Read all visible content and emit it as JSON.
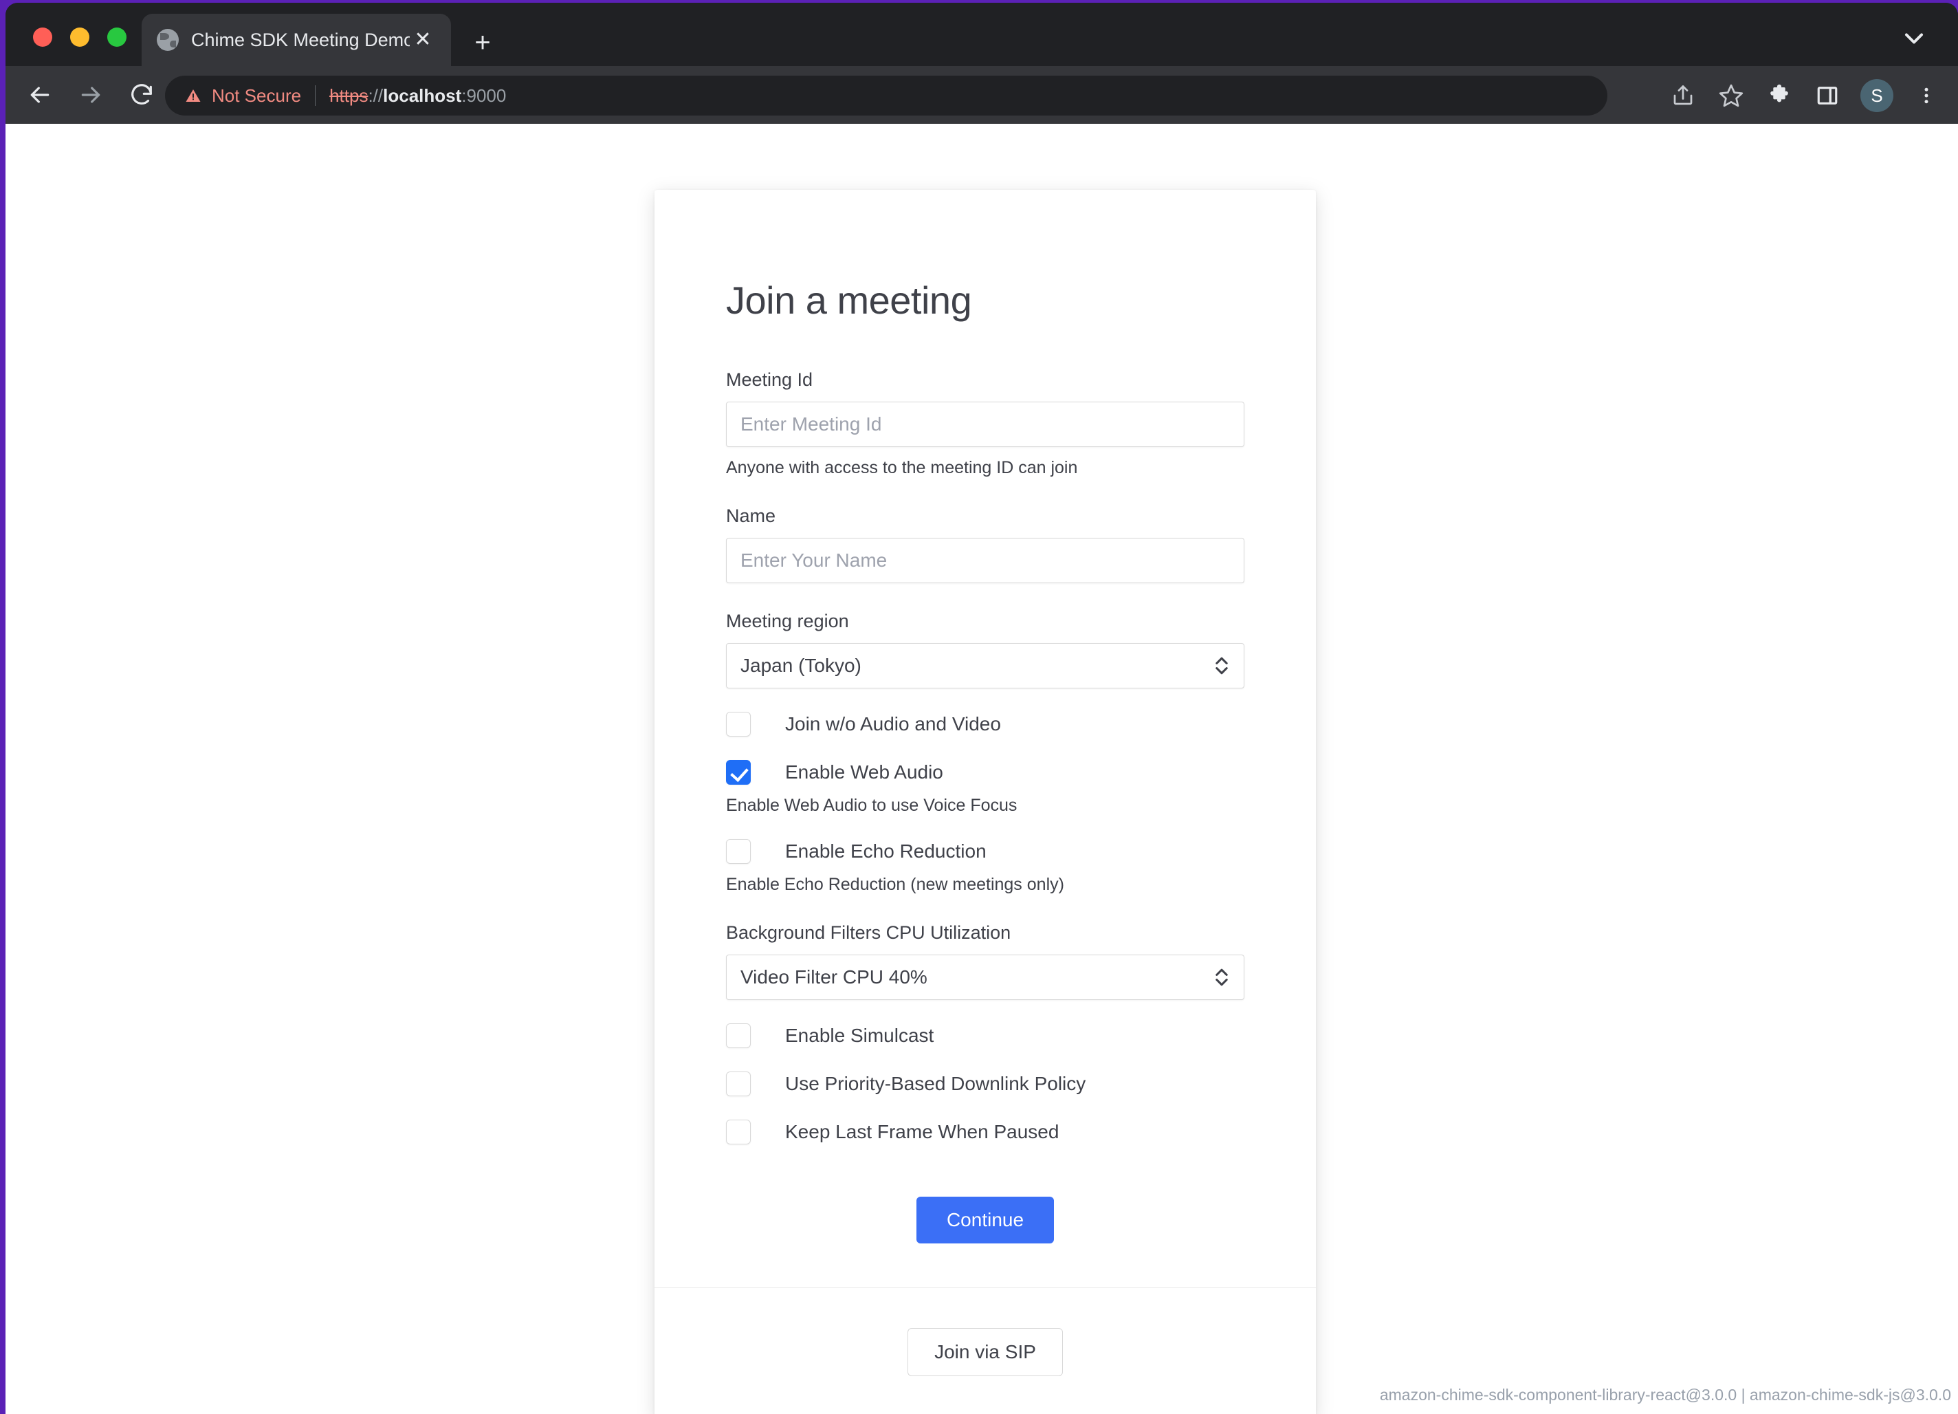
{
  "browser": {
    "tab": {
      "title": "Chime SDK Meeting Demo",
      "close_label": "✕",
      "favicon": "globe-icon"
    },
    "new_tab_label": "+",
    "nav": {
      "back_label": "←",
      "forward_label": "→",
      "reload_label": "↻"
    },
    "omnibox": {
      "security_label": "Not Secure",
      "url_scheme": "https",
      "url_slashes": "://",
      "url_host": "localhost",
      "url_port": ":9000"
    },
    "toolbar_icons": {
      "share": "share-icon",
      "bookmark": "star-icon",
      "extensions": "puzzle-icon",
      "side_panel": "side-panel-icon",
      "profile_initial": "S",
      "menu": "three-dot-menu-icon"
    }
  },
  "page": {
    "card": {
      "title": "Join a meeting",
      "meeting_id": {
        "label": "Meeting Id",
        "value": "",
        "placeholder": "Enter Meeting Id",
        "helper": "Anyone with access to the meeting ID can join"
      },
      "name": {
        "label": "Name",
        "value": "",
        "placeholder": "Enter Your Name"
      },
      "region": {
        "label": "Meeting region",
        "selected": "Japan (Tokyo)"
      },
      "checkboxes_top": [
        {
          "label": "Join w/o Audio and Video",
          "checked": false,
          "helper": ""
        },
        {
          "label": "Enable Web Audio",
          "checked": true,
          "helper": "Enable Web Audio to use Voice Focus"
        },
        {
          "label": "Enable Echo Reduction",
          "checked": false,
          "helper": "Enable Echo Reduction (new meetings only)"
        }
      ],
      "cpu": {
        "label": "Background Filters CPU Utilization",
        "selected": "Video Filter CPU 40%"
      },
      "checkboxes_bottom": [
        {
          "label": "Enable Simulcast",
          "checked": false
        },
        {
          "label": "Use Priority-Based Downlink Policy",
          "checked": false
        },
        {
          "label": "Keep Last Frame When Paused",
          "checked": false
        }
      ],
      "continue_label": "Continue",
      "sip_label": "Join via SIP"
    },
    "version_footer": "amazon-chime-sdk-component-library-react@3.0.0 | amazon-chime-sdk-js@3.0.0"
  },
  "colors": {
    "accent": "#3b6ff6",
    "checkbox_checked": "#1f6ef6",
    "warning": "#f28b82",
    "text": "#3f4149"
  }
}
